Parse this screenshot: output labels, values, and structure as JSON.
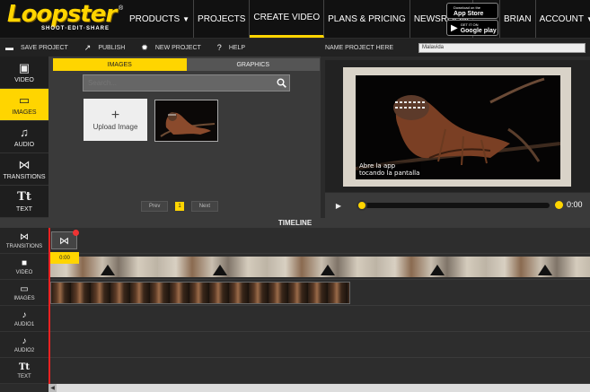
{
  "brand": {
    "logo": "Loopster",
    "tagline": "SHOOT·EDIT·SHARE",
    "registered": "®"
  },
  "nav": {
    "items": [
      {
        "label": "PRODUCTS",
        "caret": "▼"
      },
      {
        "label": "PROJECTS"
      },
      {
        "label": "CREATE VIDEO"
      },
      {
        "label": "PLANS & PRICING"
      },
      {
        "label": "NEWSROOM"
      }
    ],
    "appstore": {
      "small": "Download on the",
      "big": "App Store"
    },
    "googleplay": {
      "small": "GET IT ON",
      "big": "Google play"
    },
    "user": "BRIAN",
    "account": "ACCOUNT",
    "account_caret": "▼"
  },
  "toolbar": {
    "save": "SAVE PROJECT",
    "publish": "PUBLISH",
    "new": "NEW PROJECT",
    "help": "HELP",
    "name_label": "NAME PROJECT HERE",
    "name_value": "Malavida"
  },
  "sidebar": [
    {
      "label": "VIDEO",
      "icon": "film-icon"
    },
    {
      "label": "IMAGES",
      "icon": "image-icon"
    },
    {
      "label": "AUDIO",
      "icon": "music-icon"
    },
    {
      "label": "TRANSITIONS",
      "icon": "bowtie-icon"
    },
    {
      "label": "TEXT",
      "icon": "text-icon"
    }
  ],
  "media": {
    "tabs": [
      "IMAGES",
      "GRAPHICS"
    ],
    "search_placeholder": "Search...",
    "upload_label": "Upload Image",
    "upload_plus": "+",
    "pager": {
      "prev": "Prev",
      "page": "1",
      "next": "Next"
    }
  },
  "preview": {
    "subtitle_line1": "Abre la app",
    "subtitle_line2": "tocando la pantalla",
    "time": "0:00"
  },
  "timeline": {
    "title": "TIMELINE",
    "tracks": [
      "TRANSITIONS",
      "VIDEO",
      "IMAGES",
      "AUDIO1",
      "AUDIO2",
      "TEXT"
    ],
    "playhead_time": "0:00"
  },
  "colors": {
    "accent": "#ffd500",
    "background": "#2b2b2b",
    "playhead": "#ee2222"
  }
}
